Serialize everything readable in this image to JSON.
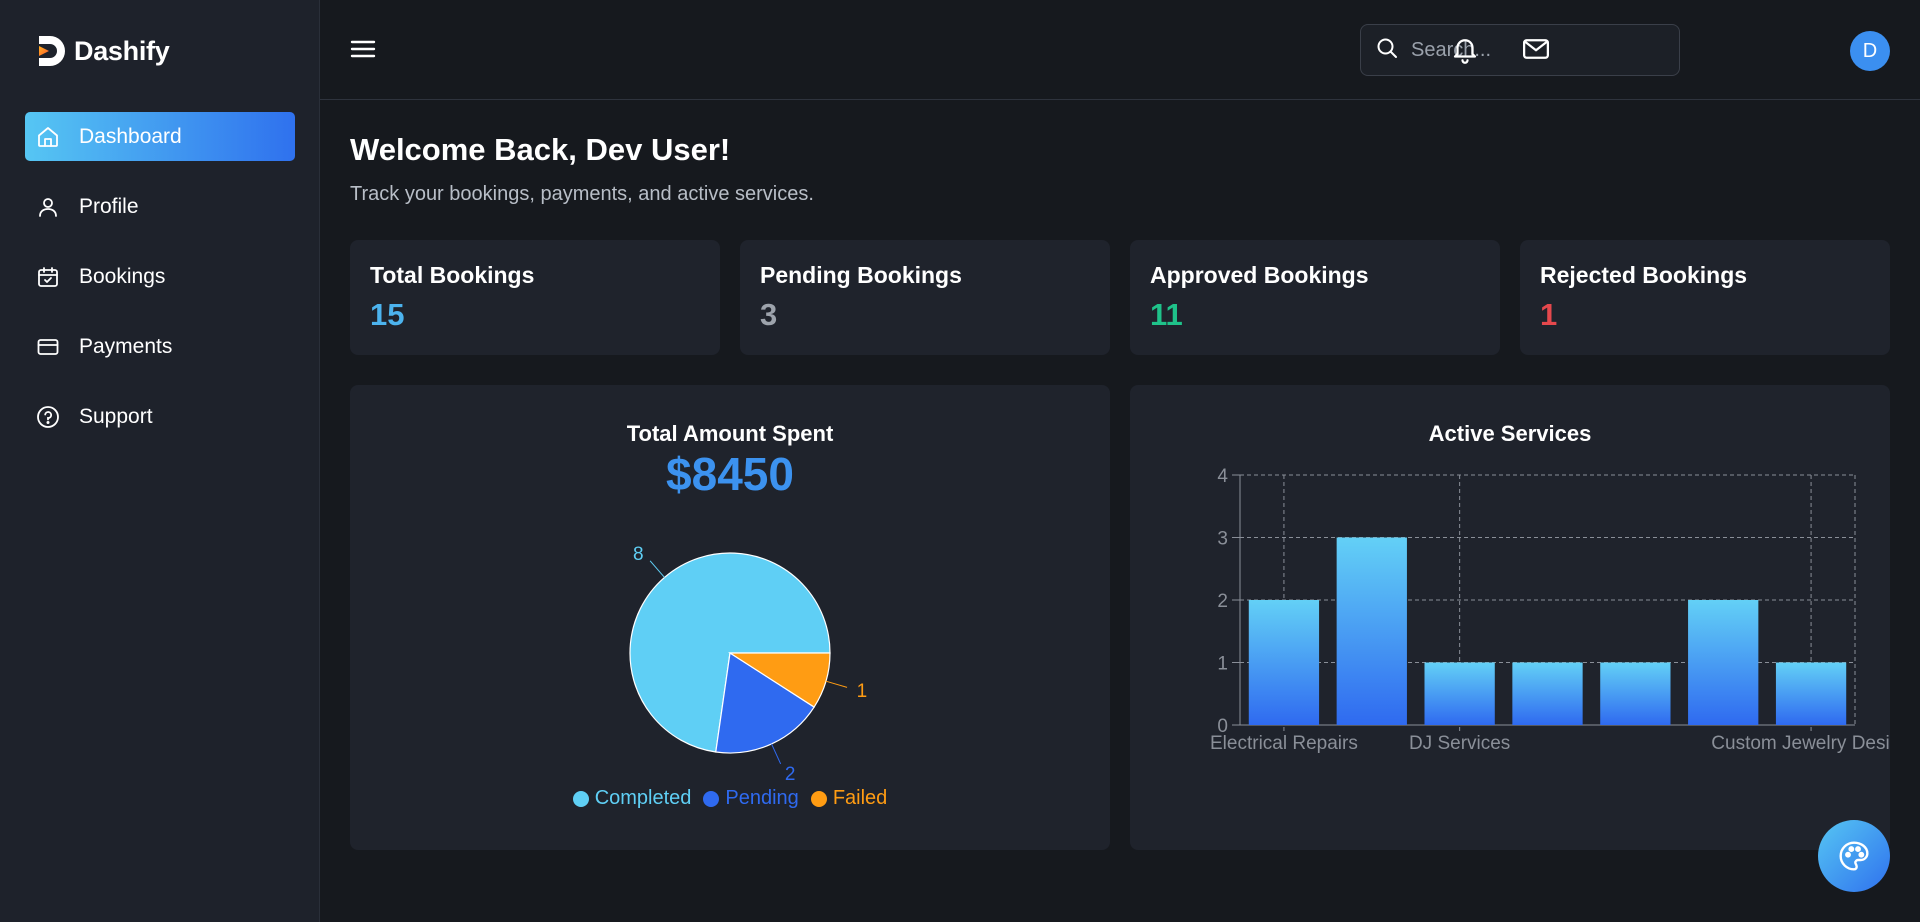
{
  "brand": {
    "name": "Dashify"
  },
  "sidebar": {
    "items": [
      {
        "label": "Dashboard",
        "icon": "home-icon",
        "active": true
      },
      {
        "label": "Profile",
        "icon": "user-icon",
        "active": false
      },
      {
        "label": "Bookings",
        "icon": "calendar-check-icon",
        "active": false
      },
      {
        "label": "Payments",
        "icon": "credit-card-icon",
        "active": false
      },
      {
        "label": "Support",
        "icon": "help-circle-icon",
        "active": false
      }
    ]
  },
  "header": {
    "search_placeholder": "Search...",
    "avatar_initial": "D"
  },
  "main": {
    "welcome": "Welcome Back, Dev User!",
    "subtitle": "Track your bookings, payments, and active services."
  },
  "stats": [
    {
      "title": "Total Bookings",
      "value": "15",
      "color": "#4cb3ee"
    },
    {
      "title": "Pending Bookings",
      "value": "3",
      "color": "#9da3ac"
    },
    {
      "title": "Approved Bookings",
      "value": "11",
      "color": "#1fc28a"
    },
    {
      "title": "Rejected Bookings",
      "value": "1",
      "color": "#e5484d"
    }
  ],
  "amount_panel": {
    "title": "Total Amount Spent",
    "amount": "$8450"
  },
  "services_panel": {
    "title": "Active Services"
  },
  "chart_data": [
    {
      "type": "pie",
      "labels": [
        "Completed",
        "Pending",
        "Failed"
      ],
      "values": [
        8,
        2,
        1
      ],
      "colors": [
        "#5fcff5",
        "#2f6af0",
        "#ff9c13"
      ],
      "legend": "bottom"
    },
    {
      "type": "bar",
      "title": "Active Services",
      "categories": [
        "Electrical Repairs",
        "",
        "DJ Services",
        "",
        "",
        "",
        "Custom Jewelry Design"
      ],
      "tick_labels": [
        "Electrical Repairs",
        "DJ Services",
        "Custom Jewelry Design"
      ],
      "values": [
        2,
        3,
        1,
        1,
        1,
        2,
        1
      ],
      "ylim": [
        0,
        4
      ],
      "yticks": [
        0,
        1,
        2,
        3,
        4
      ],
      "grid": true,
      "colors": {
        "top": "#63d0f6",
        "bottom": "#2f6af0"
      }
    }
  ]
}
